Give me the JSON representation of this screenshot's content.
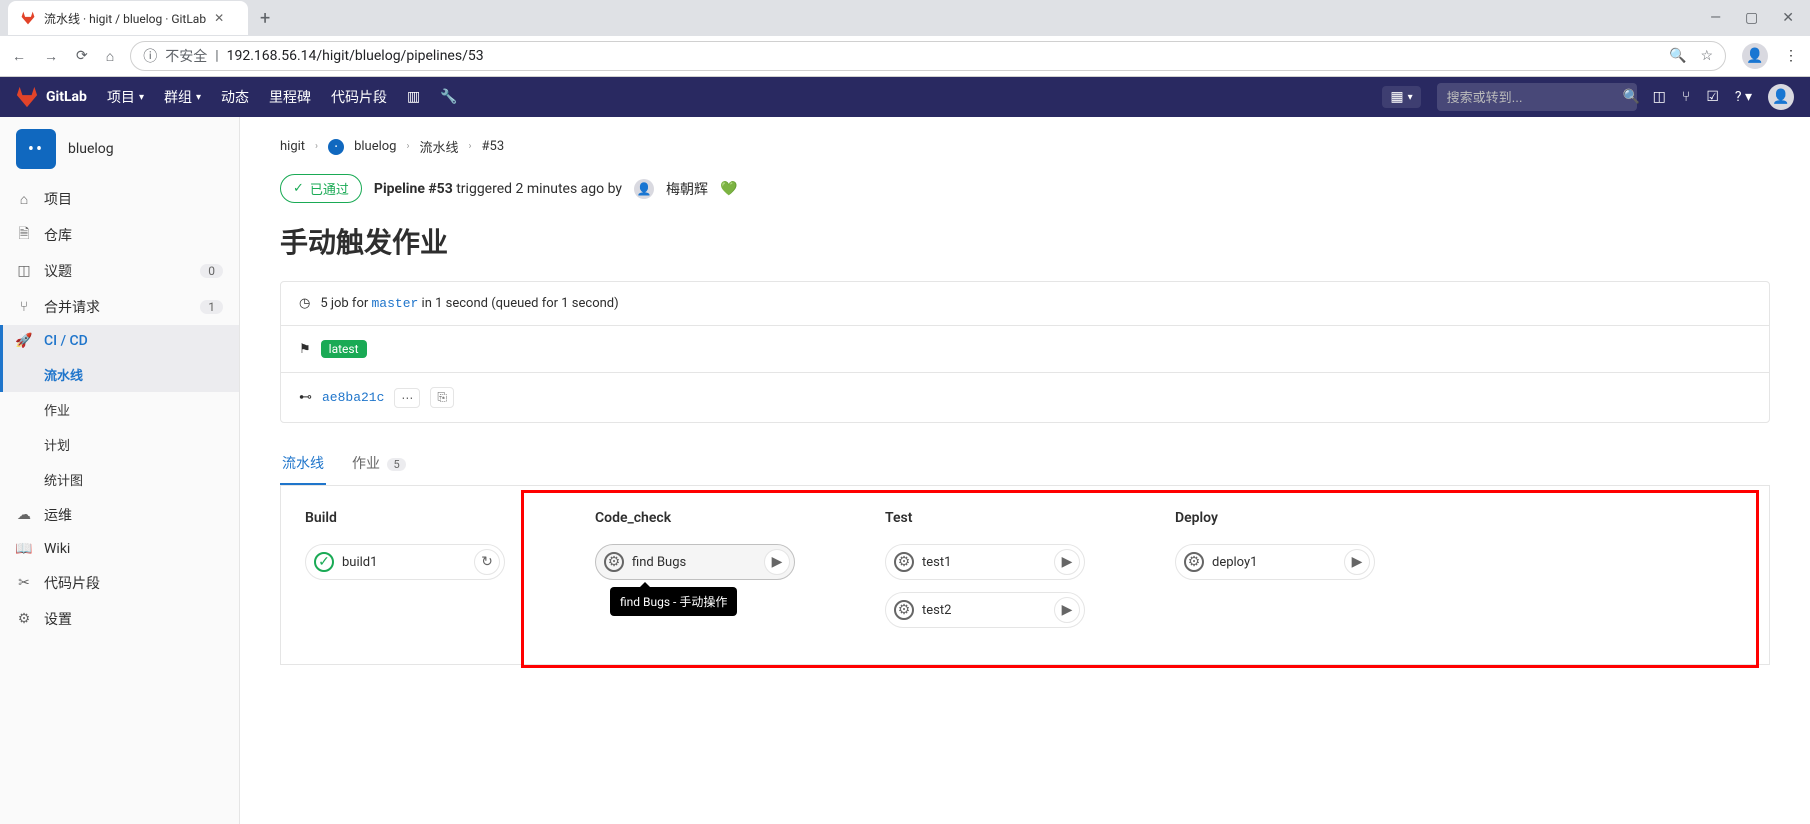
{
  "browser": {
    "tab_title": "流水线 · higit / bluelog · GitLab",
    "url_warning": "不安全",
    "url": "192.168.56.14/higit/bluelog/pipelines/53"
  },
  "topnav": {
    "brand": "GitLab",
    "items": [
      "项目",
      "群组",
      "动态",
      "里程碑",
      "代码片段"
    ],
    "search_placeholder": "搜索或转到..."
  },
  "sidebar": {
    "project": "bluelog",
    "items": [
      {
        "label": "项目",
        "icon": "home"
      },
      {
        "label": "仓库",
        "icon": "doc"
      },
      {
        "label": "议题",
        "icon": "issue",
        "badge": "0"
      },
      {
        "label": "合并请求",
        "icon": "merge",
        "badge": "1"
      },
      {
        "label": "CI / CD",
        "icon": "rocket",
        "active": true,
        "subs": [
          "流水线",
          "作业",
          "计划",
          "统计图"
        ],
        "sub_active": 0
      },
      {
        "label": "运维",
        "icon": "cloud"
      },
      {
        "label": "Wiki",
        "icon": "book"
      },
      {
        "label": "代码片段",
        "icon": "scissors"
      },
      {
        "label": "设置",
        "icon": "gear"
      }
    ]
  },
  "breadcrumbs": {
    "items": [
      "higit",
      "bluelog",
      "流水线",
      "#53"
    ]
  },
  "status": {
    "label": "已通过",
    "pipeline_strong": "Pipeline #53",
    "triggered": " triggered 2 minutes ago by ",
    "author": "梅朝辉"
  },
  "page_title": "手动触发作业",
  "info": {
    "jobs_prefix": "5 job for ",
    "branch": "master",
    "jobs_suffix": " in 1 second (queued for 1 second)",
    "tag": "latest",
    "commit": "ae8ba21c"
  },
  "tabs": {
    "pipeline": "流水线",
    "jobs": "作业",
    "jobs_count": "5"
  },
  "graph": {
    "stages": [
      {
        "name": "Build",
        "jobs": [
          {
            "label": "build1",
            "status": "pass",
            "action": "retry"
          }
        ]
      },
      {
        "name": "Code_check",
        "jobs": [
          {
            "label": "find Bugs",
            "status": "manual",
            "action": "play",
            "hover": true,
            "tooltip": "find Bugs - 手动操作"
          }
        ]
      },
      {
        "name": "Test",
        "jobs": [
          {
            "label": "test1",
            "status": "manual",
            "action": "play"
          },
          {
            "label": "test2",
            "status": "manual",
            "action": "play"
          }
        ]
      },
      {
        "name": "Deploy",
        "jobs": [
          {
            "label": "deploy1",
            "status": "manual",
            "action": "play"
          }
        ]
      }
    ]
  }
}
